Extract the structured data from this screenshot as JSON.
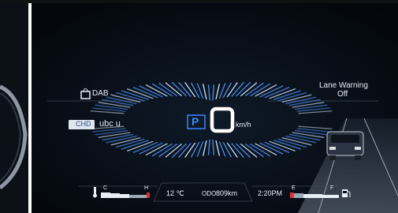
{
  "cluster": {
    "source": "DAB",
    "channel_badge": "CHD",
    "channel_name": "ubc u",
    "gear": "P",
    "speed": "0",
    "speed_unit": "km/h",
    "lane_warning_title": "Lane Warning",
    "lane_warning_state": "Off"
  },
  "status_bar": {
    "temp_cold_label": "C",
    "temp_hot_label": "H",
    "outside_temp": "12 ℃",
    "odo_label": "ODO",
    "odo_value": "809km",
    "clock": "2:20PM",
    "fuel_empty_label": "E",
    "fuel_full_label": "F"
  },
  "colors": {
    "accent_blue": "#3a86ff",
    "background": "#05090f",
    "warning_red": "#e03030"
  }
}
